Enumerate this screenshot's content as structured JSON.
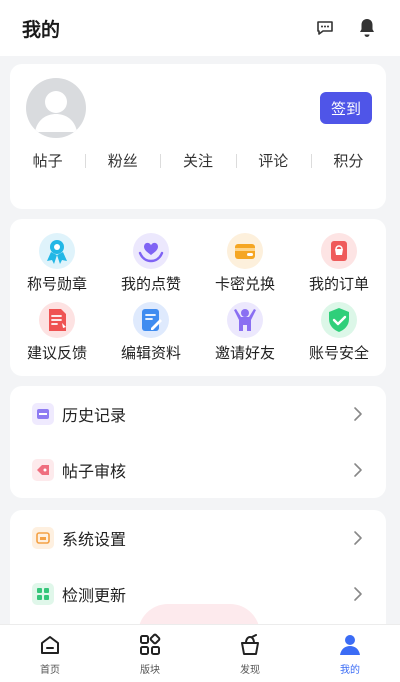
{
  "header": {
    "title": "我的",
    "icons": [
      "message-icon",
      "bell-icon"
    ]
  },
  "profile": {
    "checkin_label": "签到",
    "stats": [
      "帖子",
      "粉丝",
      "关注",
      "评论",
      "积分"
    ]
  },
  "features": [
    {
      "label": "称号勋章",
      "icon": "medal-icon",
      "color": "#22b7e6"
    },
    {
      "label": "我的点赞",
      "icon": "heart-hands-icon",
      "color": "#7f63f4"
    },
    {
      "label": "卡密兑换",
      "icon": "wallet-icon",
      "color": "#f5a623"
    },
    {
      "label": "我的订单",
      "icon": "order-icon",
      "color": "#ef5a5a"
    },
    {
      "label": "建议反馈",
      "icon": "feedback-doc-icon",
      "color": "#ef5252"
    },
    {
      "label": "编辑资料",
      "icon": "edit-doc-icon",
      "color": "#3f8cf0"
    },
    {
      "label": "邀请好友",
      "icon": "person-raise-icon",
      "color": "#8a6ff2"
    },
    {
      "label": "账号安全",
      "icon": "shield-check-icon",
      "color": "#2fcf7a"
    }
  ],
  "list_a": [
    {
      "label": "历史记录",
      "icon": "history-icon",
      "color": "#8e7bf2"
    },
    {
      "label": "帖子审核",
      "icon": "review-tag-icon",
      "color": "#ef6f7f"
    }
  ],
  "list_b": [
    {
      "label": "系统设置",
      "icon": "settings-window-icon",
      "color": "#f4a145"
    },
    {
      "label": "检测更新",
      "icon": "update-grid-icon",
      "color": "#35c57a"
    }
  ],
  "tabbar": [
    {
      "label": "首页",
      "icon": "home-icon",
      "active": false
    },
    {
      "label": "版块",
      "icon": "sections-icon",
      "active": false
    },
    {
      "label": "发现",
      "icon": "discover-icon",
      "active": false
    },
    {
      "label": "我的",
      "icon": "user-icon",
      "active": true
    }
  ],
  "colors": {
    "accent": "#4f55e8",
    "tab_active": "#3b6cf5",
    "background": "#f3f4f6"
  }
}
